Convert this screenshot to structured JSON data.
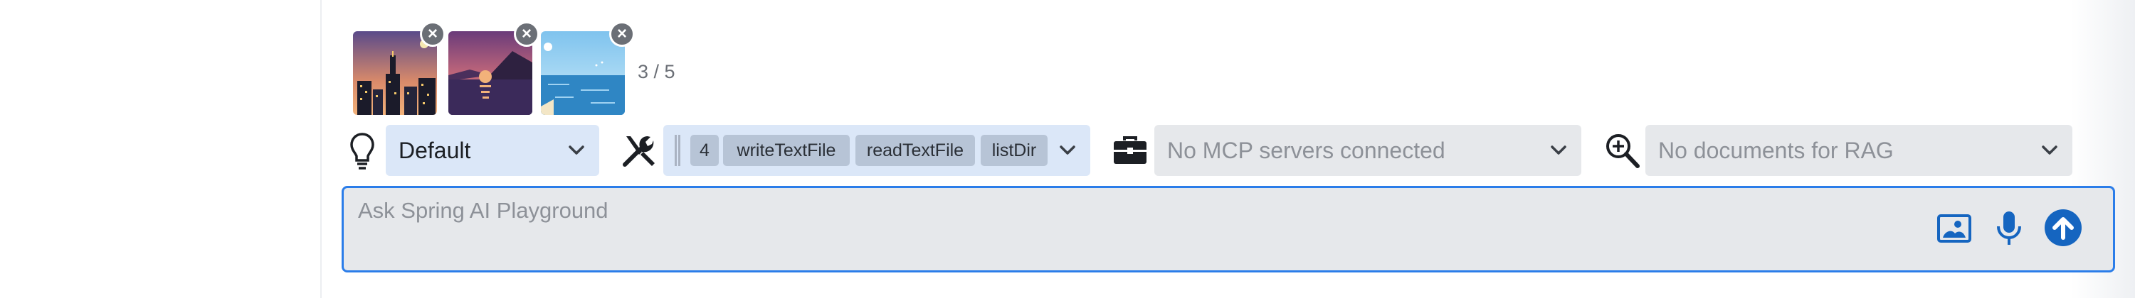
{
  "attachments": {
    "images": [
      {
        "name": "night-city-thumbnail",
        "remove_icon": "close-icon"
      },
      {
        "name": "sunset-mountain-thumbnail",
        "remove_icon": "close-icon"
      },
      {
        "name": "beach-sea-thumbnail",
        "remove_icon": "close-icon"
      }
    ],
    "remove_glyph": "×",
    "count": "3 / 5"
  },
  "toolbar": {
    "model_icon": "lightbulb-icon",
    "model_value": "Default",
    "tools_icon": "tools-icon",
    "tools": {
      "count": "4",
      "chips": [
        "writeTextFile",
        "readTextFile",
        "listDir"
      ]
    },
    "mcp_icon": "toolbox-icon",
    "mcp_placeholder": "No MCP servers connected",
    "rag_icon": "document-search-icon",
    "rag_placeholder": "No documents for RAG"
  },
  "prompt": {
    "placeholder": "Ask Spring AI Playground",
    "value": "",
    "actions": [
      "image-upload-icon",
      "microphone-icon",
      "send-icon"
    ]
  },
  "colors": {
    "accent": "#2b7de9",
    "select_active": "#dbe7f8",
    "select_disabled": "#e6e8eb",
    "chip": "#b7c4d6"
  }
}
